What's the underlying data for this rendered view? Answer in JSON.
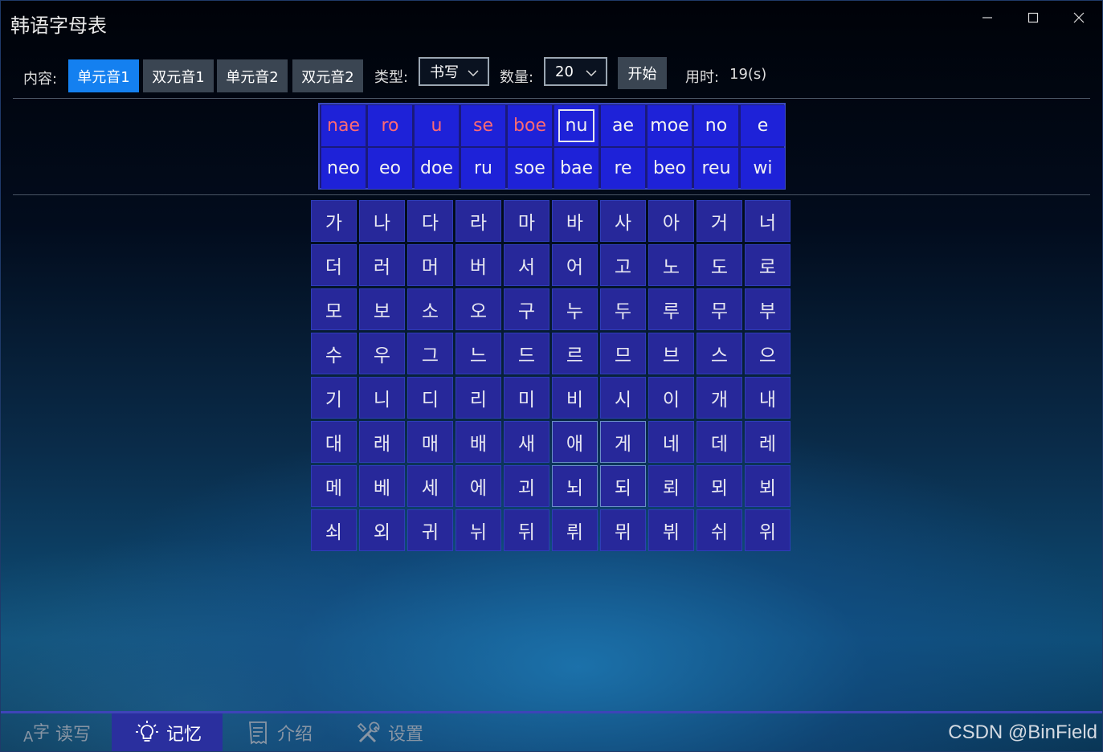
{
  "window": {
    "title": "韩语字母表",
    "minimize_icon": "minimize-icon",
    "maximize_icon": "maximize-icon",
    "close_icon": "close-icon"
  },
  "toolbar": {
    "content_label": "内容:",
    "content_tabs": [
      "单元音1",
      "双元音1",
      "单元音2",
      "双元音2"
    ],
    "active_tab": "单元音1",
    "type_label": "类型:",
    "type_value": "书写",
    "count_label": "数量:",
    "count_value": "20",
    "start_label": "开始",
    "time_label": "用时:",
    "time_value": "19(s)"
  },
  "romanization": {
    "row1": [
      "nae",
      "ro",
      "u",
      "se",
      "boe",
      "nu",
      "ae",
      "moe",
      "no",
      "e"
    ],
    "row2": [
      "neo",
      "eo",
      "doe",
      "ru",
      "soe",
      "bae",
      "re",
      "beo",
      "reu",
      "wi"
    ],
    "wrong_color": "#ff6a73",
    "wrong_items": [
      "nae",
      "ro",
      "u",
      "se",
      "boe"
    ],
    "current_item": "nu"
  },
  "hangul": {
    "rows": [
      [
        "가",
        "나",
        "다",
        "라",
        "마",
        "바",
        "사",
        "아",
        "거",
        "너"
      ],
      [
        "더",
        "러",
        "머",
        "버",
        "서",
        "어",
        "고",
        "노",
        "도",
        "로"
      ],
      [
        "모",
        "보",
        "소",
        "오",
        "구",
        "누",
        "두",
        "루",
        "무",
        "부"
      ],
      [
        "수",
        "우",
        "그",
        "느",
        "드",
        "르",
        "므",
        "브",
        "스",
        "으"
      ],
      [
        "기",
        "니",
        "디",
        "리",
        "미",
        "비",
        "시",
        "이",
        "개",
        "내"
      ],
      [
        "대",
        "래",
        "매",
        "배",
        "새",
        "애",
        "게",
        "네",
        "데",
        "레"
      ],
      [
        "메",
        "베",
        "세",
        "에",
        "괴",
        "뇌",
        "되",
        "뢰",
        "뫼",
        "뵈"
      ],
      [
        "쇠",
        "외",
        "귀",
        "뉘",
        "뒤",
        "뤼",
        "뮈",
        "뷔",
        "쉬",
        "위"
      ]
    ]
  },
  "nav": {
    "items": [
      {
        "label": "读写",
        "icon": "font-icon"
      },
      {
        "label": "记忆",
        "icon": "lightbulb-icon"
      },
      {
        "label": "介绍",
        "icon": "document-icon"
      },
      {
        "label": "设置",
        "icon": "tools-icon"
      }
    ],
    "active": "记忆"
  },
  "watermark": "CSDN @BinField",
  "colors": {
    "accent": "#1480f0",
    "cell_blue": "#1e22d8",
    "hangul_cell": "#27289a"
  }
}
